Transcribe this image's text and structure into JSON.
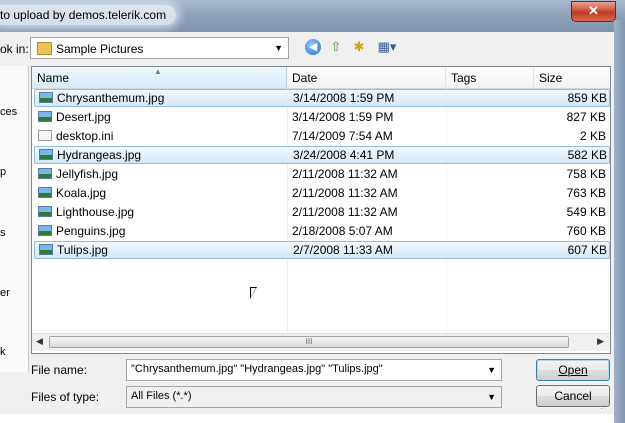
{
  "window": {
    "title": "to upload by demos.telerik.com",
    "close_glyph": "✕"
  },
  "toolbar": {
    "lookin_label": "ok in:",
    "lookin_value": "Sample Pictures",
    "back_icon": "back-arrow-icon",
    "up_icon": "up-folder-icon",
    "newfolder_icon": "new-folder-icon",
    "views_icon": "views-menu-icon"
  },
  "places": [
    "ces",
    "p",
    "s",
    "er",
    "k"
  ],
  "columns": [
    "Name",
    "Date",
    "Tags",
    "Size"
  ],
  "files": [
    {
      "name": "Chrysanthemum.jpg",
      "date": "3/14/2008 1:59 PM",
      "size": "859 KB",
      "selected": true,
      "type": "image"
    },
    {
      "name": "Desert.jpg",
      "date": "3/14/2008 1:59 PM",
      "size": "827 KB",
      "selected": false,
      "type": "image"
    },
    {
      "name": "desktop.ini",
      "date": "7/14/2009 7:54 AM",
      "size": "2 KB",
      "selected": false,
      "type": "ini"
    },
    {
      "name": "Hydrangeas.jpg",
      "date": "3/24/2008 4:41 PM",
      "size": "582 KB",
      "selected": true,
      "type": "image"
    },
    {
      "name": "Jellyfish.jpg",
      "date": "2/11/2008 11:32 AM",
      "size": "758 KB",
      "selected": false,
      "type": "image"
    },
    {
      "name": "Koala.jpg",
      "date": "2/11/2008 11:32 AM",
      "size": "763 KB",
      "selected": false,
      "type": "image"
    },
    {
      "name": "Lighthouse.jpg",
      "date": "2/11/2008 11:32 AM",
      "size": "549 KB",
      "selected": false,
      "type": "image"
    },
    {
      "name": "Penguins.jpg",
      "date": "2/18/2008 5:07 AM",
      "size": "760 KB",
      "selected": false,
      "type": "image"
    },
    {
      "name": "Tulips.jpg",
      "date": "2/7/2008 11:33 AM",
      "size": "607 KB",
      "selected": true,
      "type": "image"
    }
  ],
  "scrollbar": {
    "grip": "III"
  },
  "filename": {
    "label": "File name:",
    "value": "\"Chrysanthemum.jpg\" \"Hydrangeas.jpg\" \"Tulips.jpg\""
  },
  "filetype": {
    "label": "Files of type:",
    "value": "All Files (*.*)"
  },
  "buttons": {
    "open": "Open",
    "cancel": "Cancel"
  }
}
